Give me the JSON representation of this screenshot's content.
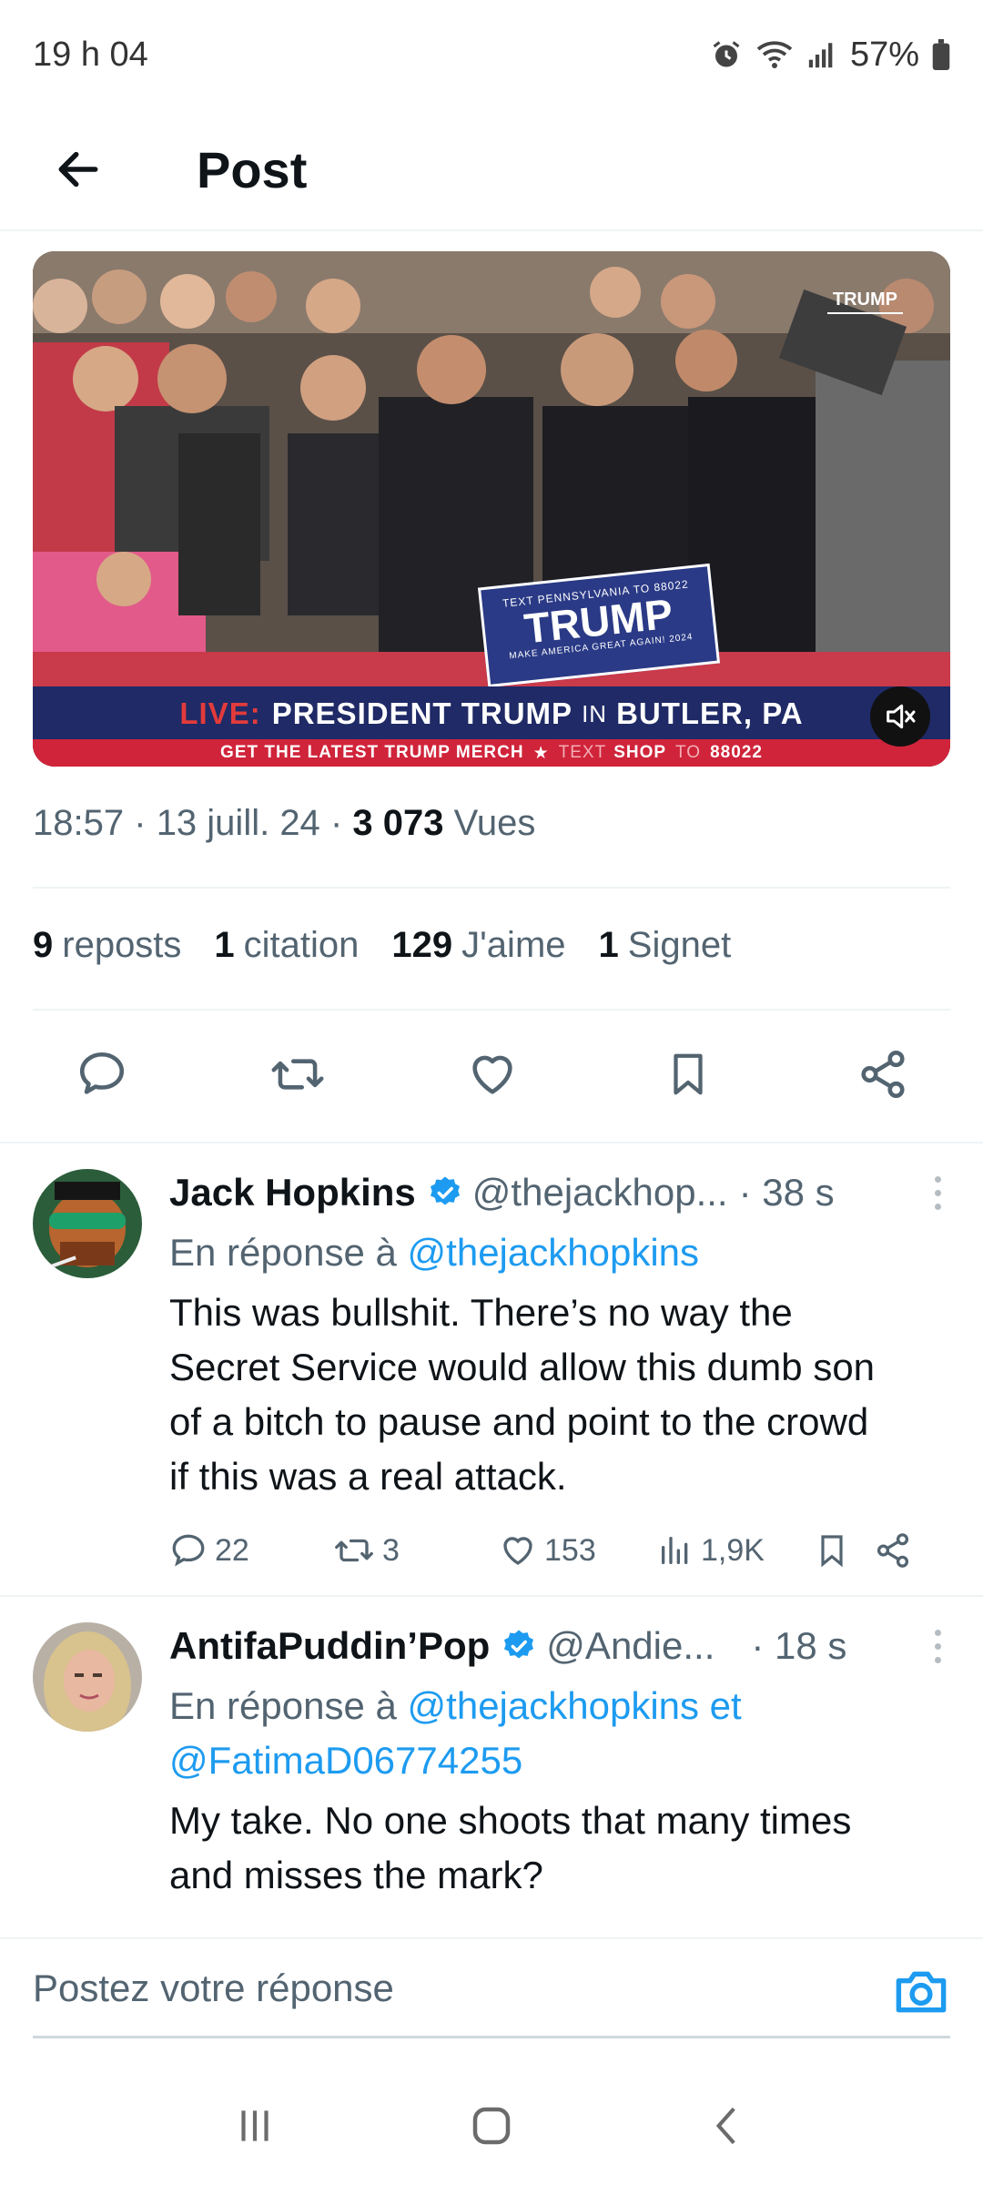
{
  "status_bar": {
    "time": "19 h 04",
    "battery": "57%"
  },
  "header": {
    "title": "Post"
  },
  "media": {
    "banner_live": "LIVE:",
    "banner_main_1": "PRESIDENT TRUMP",
    "banner_in": "IN",
    "banner_main_2": "BUTLER, PA",
    "merch_1": "GET THE LATEST TRUMP MERCH",
    "merch_star": "★",
    "merch_2": "TEXT",
    "merch_3": "SHOP",
    "merch_4": "TO",
    "merch_5": "88022",
    "sign_top": "TEXT PENNSYLVANIA TO 88022",
    "sign_main": "TRUMP",
    "sign_sub": "MAKE AMERICA GREAT AGAIN! 2024",
    "corner_logo": "TRUMP"
  },
  "post_meta": {
    "time": "18:57",
    "sep1": "·",
    "date": "13 juill. 24",
    "sep2": "·",
    "views_count": "3 073",
    "views_label": "Vues"
  },
  "stats": {
    "reposts_count": "9",
    "reposts_label": "reposts",
    "quotes_count": "1",
    "quotes_label": "citation",
    "likes_count": "129",
    "likes_label": "J'aime",
    "bookmarks_count": "1",
    "bookmarks_label": "Signet"
  },
  "replies": [
    {
      "name": "Jack Hopkins",
      "handle": "@thejackhop...",
      "time": "· 38 s",
      "reply_prefix": "En réponse à",
      "reply_link": "@thejackhopkins",
      "text_lines": [
        "This was bullshit. There’s no way the",
        "Secret Service would allow this dumb son",
        "of a bitch to pause and point to the crowd",
        "if this was a real attack."
      ],
      "replies": "22",
      "reposts": "3",
      "likes": "153",
      "views": "1,9K"
    },
    {
      "name": "AntifaPuddin’Pop",
      "handle": "@Andie...",
      "time": "· 18 s",
      "reply_prefix": "En réponse à",
      "reply_link": "@thejackhopkins et",
      "reply_link_2": "@FatimaD06774255",
      "text_lines": [
        "My take. No one shoots that many times",
        "and misses the mark?"
      ]
    }
  ],
  "compose": {
    "placeholder": "Postez votre réponse"
  },
  "colors": {
    "accent": "#1d9bf0",
    "text": "#0f1419",
    "muted": "#536471"
  },
  "icons": [
    "back-arrow-icon",
    "reply-icon",
    "repost-icon",
    "like-icon",
    "bookmark-icon",
    "share-icon",
    "verified-icon",
    "camera-icon",
    "mute-icon",
    "alarm-icon",
    "wifi-icon",
    "signal-icon",
    "battery-icon"
  ]
}
